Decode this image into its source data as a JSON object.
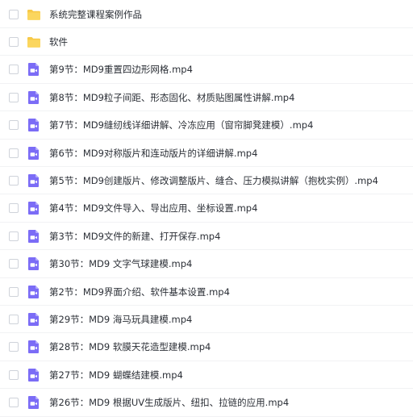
{
  "files": [
    {
      "name": "系统完整课程案例作品",
      "type": "folder"
    },
    {
      "name": "软件",
      "type": "folder"
    },
    {
      "name": "第9节：MD9重置四边形网格.mp4",
      "type": "video"
    },
    {
      "name": "第8节：MD9粒子间距、形态固化、材质贴图属性讲解.mp4",
      "type": "video"
    },
    {
      "name": "第7节：MD9缝纫线详细讲解、冷冻应用（窗帘脚凳建模）.mp4",
      "type": "video"
    },
    {
      "name": "第6节：MD9对称版片和连动版片的详细讲解.mp4",
      "type": "video"
    },
    {
      "name": "第5节：MD9创建版片、修改调整版片、缝合、压力模拟讲解（抱枕实例）.mp4",
      "type": "video"
    },
    {
      "name": "第4节：MD9文件导入、导出应用、坐标设置.mp4",
      "type": "video"
    },
    {
      "name": "第3节：MD9文件的新建、打开保存.mp4",
      "type": "video"
    },
    {
      "name": "第30节：MD9 文字气球建模.mp4",
      "type": "video"
    },
    {
      "name": "第2节：MD9界面介绍、软件基本设置.mp4",
      "type": "video"
    },
    {
      "name": "第29节：MD9 海马玩具建模.mp4",
      "type": "video"
    },
    {
      "name": "第28节：MD9 软膜天花造型建模.mp4",
      "type": "video"
    },
    {
      "name": "第27节：MD9 蝴蝶结建模.mp4",
      "type": "video"
    },
    {
      "name": "第26节：MD9 根据UV生成版片、纽扣、拉链的应用.mp4",
      "type": "video"
    }
  ],
  "colors": {
    "folder": "#f7c948",
    "video": "#7b6cf6"
  }
}
